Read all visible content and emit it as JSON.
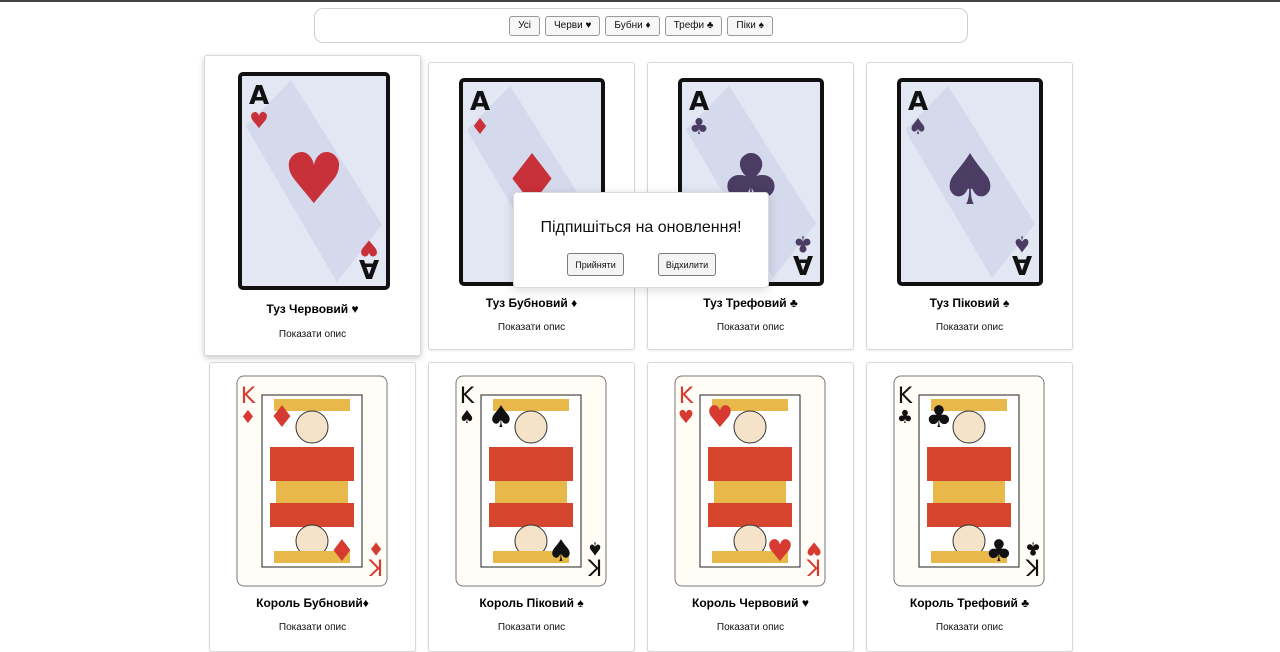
{
  "filters": [
    "Усі",
    "Черви ♥",
    "Бубни ♦",
    "Трефи ♣",
    "Піки ♠"
  ],
  "colors": {
    "red": "#d63a31",
    "aceRed": "#c8303a",
    "aceDark": "#4a3c63",
    "aceBg": "#e3e6f3"
  },
  "cards": [
    {
      "title": "Туз Червовий ♥",
      "desc": "Показати опис",
      "rank": "A",
      "suit": "♥",
      "kind": "ace",
      "suit_color": "#c8303a"
    },
    {
      "title": "Туз Бубновий ♦",
      "desc": "Показати опис",
      "rank": "A",
      "suit": "♦",
      "kind": "ace",
      "suit_color": "#c8303a"
    },
    {
      "title": "Туз Трефовий ♣",
      "desc": "Показати опис",
      "rank": "A",
      "suit": "♣",
      "kind": "ace",
      "suit_color": "#4a3c63"
    },
    {
      "title": "Туз Піковий ♠",
      "desc": "Показати опис",
      "rank": "A",
      "suit": "♠",
      "kind": "ace",
      "suit_color": "#4a3c63"
    },
    {
      "title": "Король Бубновий♦",
      "desc": "Показати опис",
      "rank": "K",
      "suit": "♦",
      "kind": "king",
      "suit_color": "#d63a31"
    },
    {
      "title": "Король Піковий ♠",
      "desc": "Показати опис",
      "rank": "K",
      "suit": "♠",
      "kind": "king",
      "suit_color": "#111111"
    },
    {
      "title": "Король Червовий ♥",
      "desc": "Показати опис",
      "rank": "K",
      "suit": "♥",
      "kind": "king",
      "suit_color": "#d63a31"
    },
    {
      "title": "Король Трефовий ♣",
      "desc": "Показати опис",
      "rank": "K",
      "suit": "♣",
      "kind": "king",
      "suit_color": "#111111"
    }
  ],
  "modal": {
    "message": "Підпишіться на оновлення!",
    "accept": "Прийняти",
    "decline": "Відхилити"
  }
}
